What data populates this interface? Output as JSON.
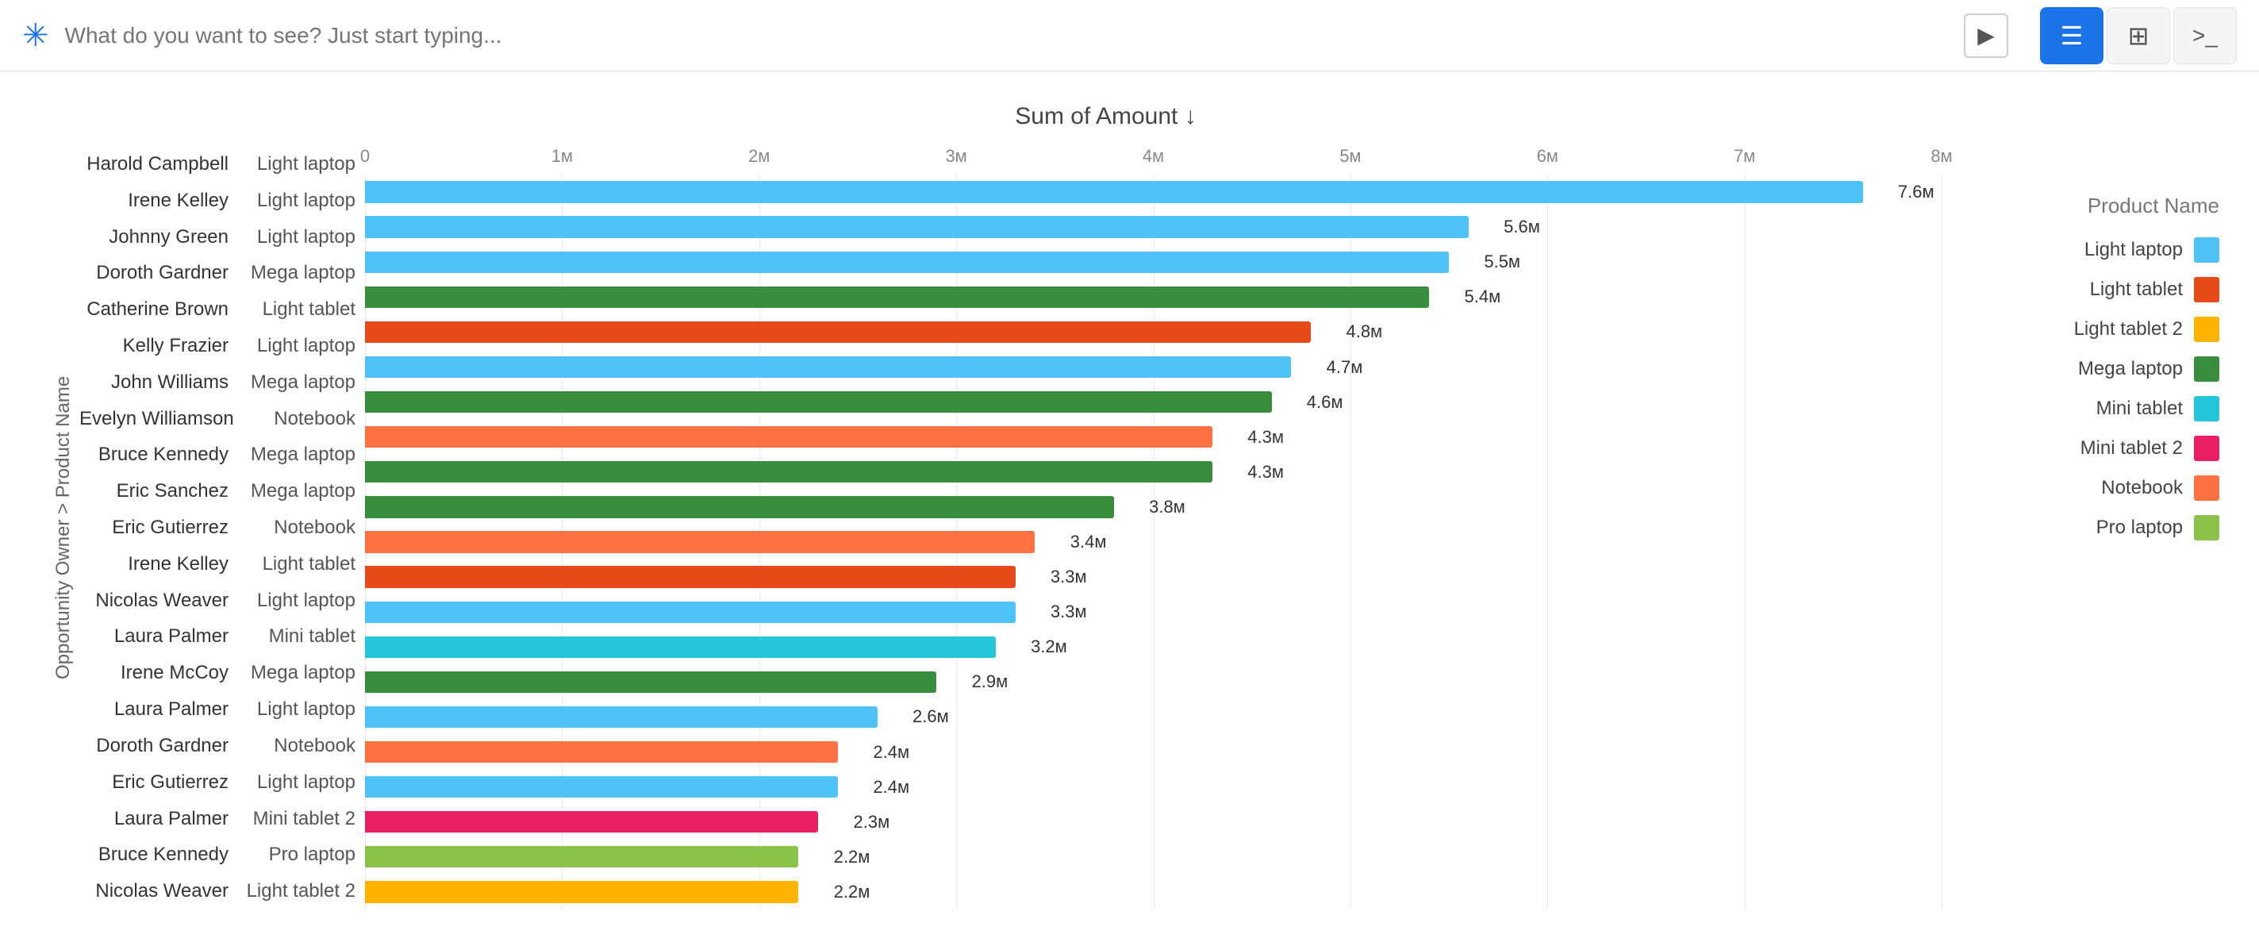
{
  "topbar": {
    "search_placeholder": "What do you want to see? Just start typing...",
    "chart_icon": "≡",
    "table_icon": "⊞",
    "code_icon": ">_"
  },
  "chart": {
    "title": "Sum of Amount ↓",
    "y_axis_label": "Opportunity Owner > Product Name",
    "x_axis_labels": [
      "0",
      "1м",
      "2м",
      "3м",
      "4м",
      "5м",
      "6м",
      "7м",
      "8м"
    ],
    "max_value": 8000000,
    "rows": [
      {
        "owner": "Harold Campbell",
        "product": "Light laptop",
        "value": 7600000,
        "label": "7.6м",
        "color": "#4FC3F7",
        "pct": 95
      },
      {
        "owner": "Irene Kelley",
        "product": "Light laptop",
        "value": 5600000,
        "label": "5.6м",
        "color": "#4FC3F7",
        "pct": 70
      },
      {
        "owner": "Johnny Green",
        "product": "Light laptop",
        "value": 5500000,
        "label": "5.5м",
        "color": "#4FC3F7",
        "pct": 68.75
      },
      {
        "owner": "Doroth Gardner",
        "product": "Mega laptop",
        "value": 5400000,
        "label": "5.4м",
        "color": "#388E3C",
        "pct": 67.5
      },
      {
        "owner": "Catherine Brown",
        "product": "Light tablet",
        "value": 4800000,
        "label": "4.8м",
        "color": "#E64A19",
        "pct": 60
      },
      {
        "owner": "Kelly Frazier",
        "product": "Light laptop",
        "value": 4700000,
        "label": "4.7м",
        "color": "#4FC3F7",
        "pct": 58.75
      },
      {
        "owner": "John Williams",
        "product": "Mega laptop",
        "value": 4600000,
        "label": "4.6м",
        "color": "#388E3C",
        "pct": 57.5
      },
      {
        "owner": "Evelyn Williamson",
        "product": "Notebook",
        "value": 4300000,
        "label": "4.3м",
        "color": "#FF7043",
        "pct": 53.75
      },
      {
        "owner": "Bruce Kennedy",
        "product": "Mega laptop",
        "value": 4300000,
        "label": "4.3м",
        "color": "#388E3C",
        "pct": 53.75
      },
      {
        "owner": "Eric Sanchez",
        "product": "Mega laptop",
        "value": 3800000,
        "label": "3.8м",
        "color": "#388E3C",
        "pct": 47.5
      },
      {
        "owner": "Eric Gutierrez",
        "product": "Notebook",
        "value": 3400000,
        "label": "3.4м",
        "color": "#FF7043",
        "pct": 42.5
      },
      {
        "owner": "Irene Kelley",
        "product": "Light tablet",
        "value": 3300000,
        "label": "3.3м",
        "color": "#E64A19",
        "pct": 41.25
      },
      {
        "owner": "Nicolas Weaver",
        "product": "Light laptop",
        "value": 3300000,
        "label": "3.3м",
        "color": "#4FC3F7",
        "pct": 41.25
      },
      {
        "owner": "Laura Palmer",
        "product": "Mini tablet",
        "value": 3200000,
        "label": "3.2м",
        "color": "#26C6DA",
        "pct": 40
      },
      {
        "owner": "Irene McCoy",
        "product": "Mega laptop",
        "value": 2900000,
        "label": "2.9м",
        "color": "#388E3C",
        "pct": 36.25
      },
      {
        "owner": "Laura Palmer",
        "product": "Light laptop",
        "value": 2600000,
        "label": "2.6м",
        "color": "#4FC3F7",
        "pct": 32.5
      },
      {
        "owner": "Doroth Gardner",
        "product": "Notebook",
        "value": 2400000,
        "label": "2.4м",
        "color": "#FF7043",
        "pct": 30
      },
      {
        "owner": "Eric Gutierrez",
        "product": "Light laptop",
        "value": 2400000,
        "label": "2.4м",
        "color": "#4FC3F7",
        "pct": 30
      },
      {
        "owner": "Laura Palmer",
        "product": "Mini tablet 2",
        "value": 2300000,
        "label": "2.3м",
        "color": "#E91E63",
        "pct": 28.75
      },
      {
        "owner": "Bruce Kennedy",
        "product": "Pro laptop",
        "value": 2200000,
        "label": "2.2м",
        "color": "#8BC34A",
        "pct": 27.5
      },
      {
        "owner": "Nicolas Weaver",
        "product": "Light tablet 2",
        "value": 2200000,
        "label": "2.2м",
        "color": "#FFB300",
        "pct": 27.5
      }
    ]
  },
  "legend": {
    "title": "Product Name",
    "items": [
      {
        "label": "Light laptop",
        "color": "#4FC3F7"
      },
      {
        "label": "Light tablet",
        "color": "#E64A19"
      },
      {
        "label": "Light tablet 2",
        "color": "#FFB300"
      },
      {
        "label": "Mega laptop",
        "color": "#388E3C"
      },
      {
        "label": "Mini tablet",
        "color": "#26C6DA"
      },
      {
        "label": "Mini tablet 2",
        "color": "#E91E63"
      },
      {
        "label": "Notebook",
        "color": "#FF7043"
      },
      {
        "label": "Pro laptop",
        "color": "#8BC34A"
      }
    ]
  }
}
